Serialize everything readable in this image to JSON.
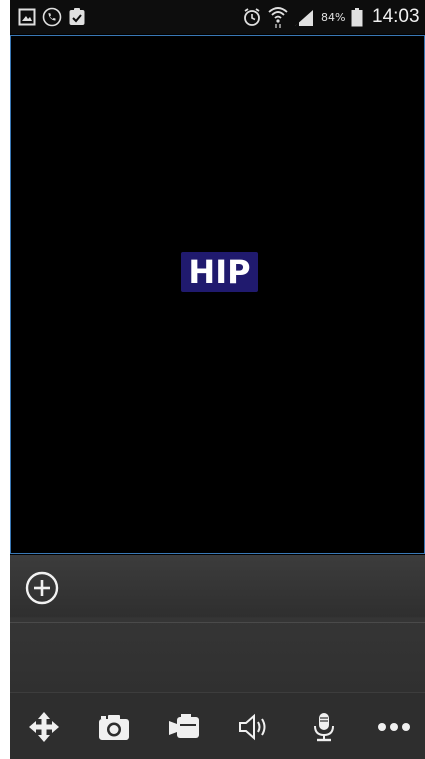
{
  "status_bar": {
    "battery_percent": "84%",
    "time": "14:03",
    "icons": [
      "gallery-icon",
      "call-icon",
      "clipboard-check-icon",
      "alarm-icon",
      "wifi-icon",
      "signal-icon",
      "battery-icon"
    ]
  },
  "viewport": {
    "logo_text": "HIP",
    "logo_color": "#201a6e",
    "border_color": "#3a78b5"
  },
  "panel": {
    "add_icon": "plus-circle-icon"
  },
  "toolbar": {
    "tools": [
      "move-icon",
      "camera-icon",
      "video-camera-icon",
      "speaker-icon",
      "microphone-icon",
      "more-icon"
    ]
  }
}
